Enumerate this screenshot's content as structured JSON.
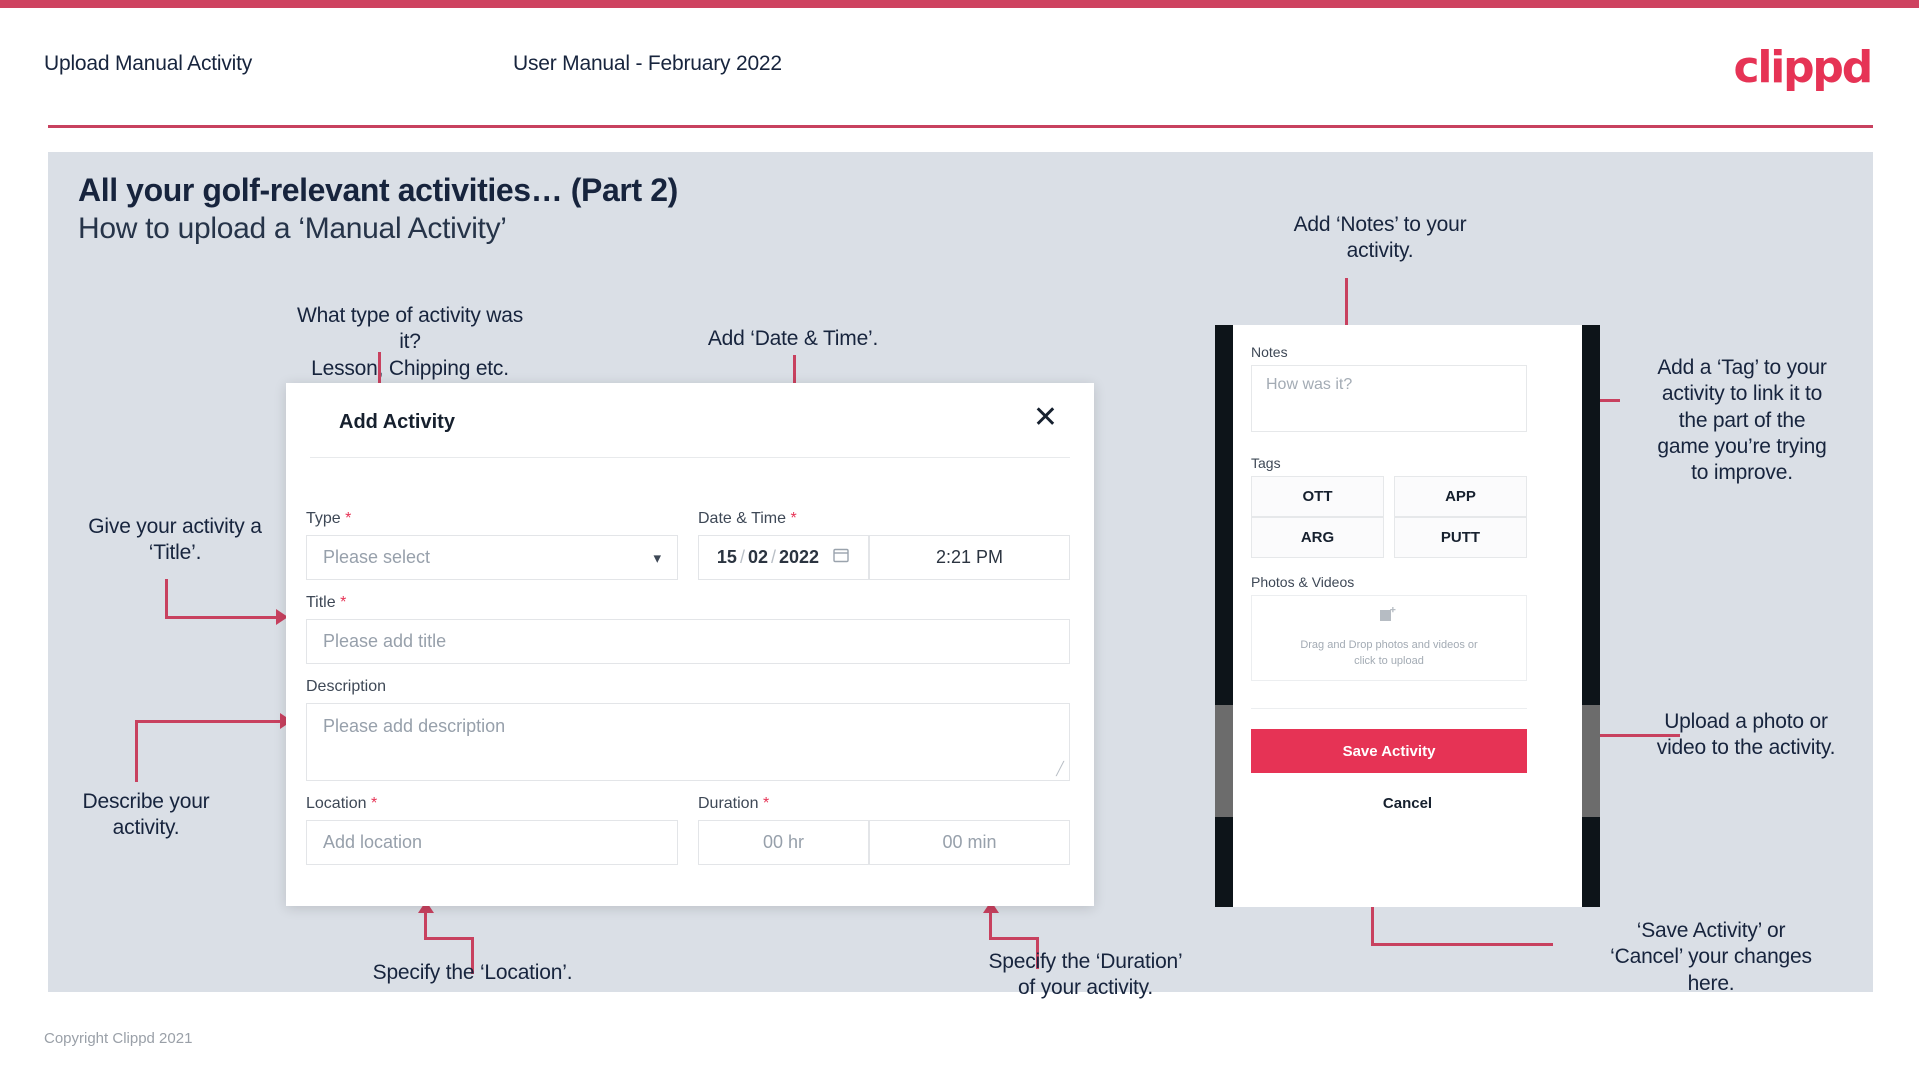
{
  "header": {
    "left_title": "Upload Manual Activity",
    "center_title": "User Manual - February 2022",
    "logo": "clippd"
  },
  "slide": {
    "title": "All your golf-relevant activities… (Part 2)",
    "subtitle": "How to upload a ‘Manual Activity’"
  },
  "annotations": {
    "type": "What type of activity was it?\nLesson, Chipping etc.",
    "datetime": "Add ‘Date & Time’.",
    "title": "Give your activity a\n‘Title’.",
    "description": "Describe your\nactivity.",
    "location": "Specify the ‘Location’.",
    "duration": "Specify the ‘Duration’\nof your activity.",
    "notes": "Add ‘Notes’ to your\nactivity.",
    "tags": "Add a ‘Tag’ to your\nactivity to link it to\nthe part of the\ngame you’re trying\nto improve.",
    "photos": "Upload a photo or\nvideo to the activity.",
    "save": "‘Save Activity’ or\n‘Cancel’ your changes\nhere."
  },
  "dialog": {
    "title": "Add Activity",
    "close_icon": "close-icon",
    "fields": {
      "type_label": "Type",
      "type_placeholder": "Please select",
      "datetime_label": "Date & Time",
      "date_day": "15",
      "date_sep1": "/",
      "date_month": "02",
      "date_sep2": "/",
      "date_year": "2022",
      "time_value": "2:21 PM",
      "title_label": "Title",
      "title_placeholder": "Please add title",
      "description_label": "Description",
      "description_placeholder": "Please add description",
      "location_label": "Location",
      "location_placeholder": "Add location",
      "duration_label": "Duration",
      "duration_hours_placeholder": "00 hr",
      "duration_minutes_placeholder": "00 min"
    },
    "required_marker": "*"
  },
  "phone": {
    "notes_label": "Notes",
    "notes_placeholder": "How was it?",
    "tags_label": "Tags",
    "tags": [
      "OTT",
      "APP",
      "ARG",
      "PUTT"
    ],
    "photos_label": "Photos & Videos",
    "upload_text_line1": "Drag and Drop photos and videos or",
    "upload_text_line2": "click to upload",
    "save_label": "Save Activity",
    "cancel_label": "Cancel"
  },
  "footer": {
    "copyright": "Copyright Clippd 2021"
  },
  "colors": {
    "accent": "#e63355",
    "line": "#c8415f",
    "slide_bg": "#dadfe6",
    "text_dark": "#17243d"
  }
}
